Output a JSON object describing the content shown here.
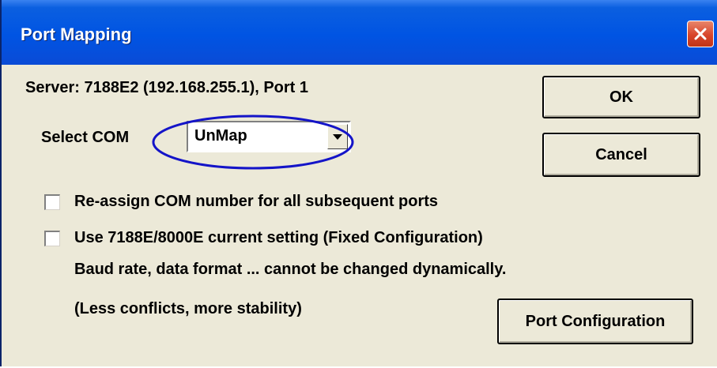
{
  "window": {
    "title": "Port Mapping",
    "close_icon": "close-icon"
  },
  "server_info": "Server: 7188E2 (192.168.255.1), Port 1",
  "select_com": {
    "label": "Select COM",
    "value": "UnMap",
    "arrow_icon": "dropdown-arrow-icon"
  },
  "buttons": {
    "ok": "OK",
    "cancel": "Cancel",
    "port_configuration": "Port Configuration"
  },
  "checkboxes": [
    {
      "label": "Re-assign COM number for all subsequent ports",
      "checked": false
    },
    {
      "label": "Use 7188E/8000E current setting (Fixed Configuration)",
      "checked": false
    }
  ],
  "notes": {
    "line1": "Baud rate, data format ... cannot be changed dynamically.",
    "line2": "(Less conflicts, more stability)"
  },
  "colors": {
    "titlebar": "#0054e3",
    "dialog_bg": "#ece9d8",
    "close_button": "#d8452b",
    "annotation_ellipse": "#1414c8"
  }
}
